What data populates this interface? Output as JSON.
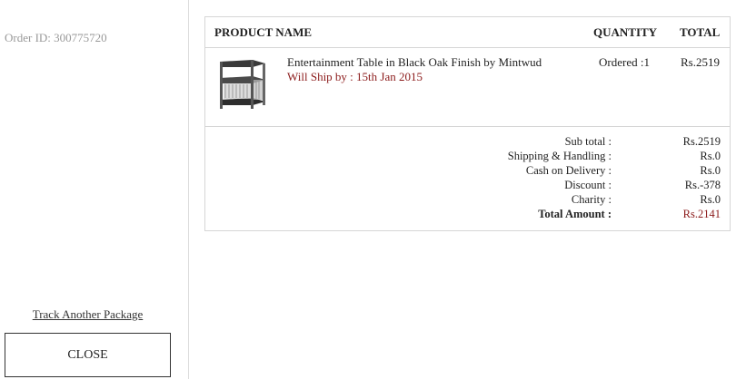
{
  "sidebar": {
    "order_id": "Order ID: 300775720",
    "track_link": "Track Another Package",
    "close_label": "CLOSE"
  },
  "table": {
    "headers": {
      "product": "PRODUCT NAME",
      "quantity": "QUANTITY",
      "total": "TOTAL"
    },
    "item": {
      "name": "Entertainment Table in Black Oak Finish by Mintwud",
      "ship_by": "Will Ship by : 15th Jan 2015",
      "quantity": "Ordered :1",
      "total": "Rs.2519",
      "image_icon": "entertainment-table-image"
    }
  },
  "summary": [
    {
      "label": "Sub total :",
      "value": "Rs.2519"
    },
    {
      "label": "Shipping & Handling :",
      "value": "Rs.0"
    },
    {
      "label": "Cash on Delivery :",
      "value": "Rs.0"
    },
    {
      "label": "Discount :",
      "value": "Rs.-378"
    },
    {
      "label": "Charity :",
      "value": "Rs.0"
    },
    {
      "label": "Total Amount :",
      "value": "Rs.2141"
    }
  ],
  "colors": {
    "accent_red": "#8b1a1a",
    "muted_text": "#999999",
    "border": "#d6d6d6"
  }
}
